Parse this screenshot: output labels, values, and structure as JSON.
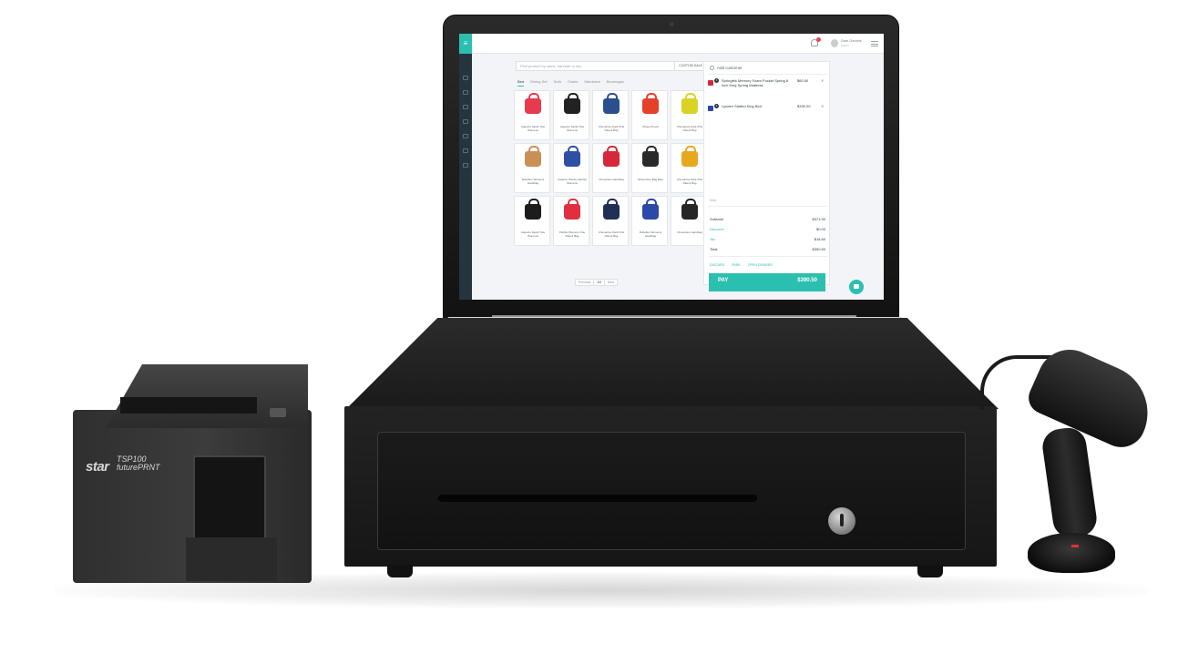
{
  "topbar": {
    "user_name": "Sam Daniels",
    "user_role": "Admin"
  },
  "search": {
    "placeholder": "Find product by name, barcode or sku",
    "custom_sale": "CUSTOM SALE"
  },
  "tabs": [
    "Bed",
    "Dining Set",
    "Sofa",
    "Chairs",
    "Wardrobe",
    "Beverages"
  ],
  "products": [
    {
      "name": "Capezio Sarah Tote Womens",
      "color": "#e63b4f"
    },
    {
      "name": "Capezio Sarah Tote Womens",
      "color": "#222222"
    },
    {
      "name": "Chevantoo Dark Pink Patent Bag",
      "color": "#2b4f8c"
    },
    {
      "name": "Shoes Pouch",
      "color": "#e4402a"
    },
    {
      "name": "Chevantoo Dark Pink Patent Bag",
      "color": "#d8d324"
    },
    {
      "name": "Rubellen Womens Handbag",
      "color": "#c98f55"
    },
    {
      "name": "Capezio Wesby Satchel Womens",
      "color": "#2e4fa3"
    },
    {
      "name": "Chevantoo Handbag",
      "color": "#d6283a"
    },
    {
      "name": "Shoes Run Bag Blue",
      "color": "#2a2a2a"
    },
    {
      "name": "Chevantoo Dark Pink Patent Bag",
      "color": "#e6a81d"
    },
    {
      "name": "Capezio Sarah Tote Womens",
      "color": "#1c1c1c"
    },
    {
      "name": "Pebble Womens Tote Patent Bag",
      "color": "#e03040"
    },
    {
      "name": "Chevantoo Dark Pink Patent Bag",
      "color": "#1f2f55"
    },
    {
      "name": "Rubellen Womens Handbag",
      "color": "#2a49a8"
    },
    {
      "name": "Chevantoo Handbag",
      "color": "#262626"
    }
  ],
  "pager": {
    "prev": "Previous",
    "current": "1/3",
    "next": "Next"
  },
  "cart": {
    "add_customer": "Add customer",
    "lines": [
      {
        "qty": "1",
        "name": "Springtek Memory Foam Pocket Spring 8 inch King Spring Mattress",
        "price": "$60.50",
        "thumb": "#d6283a"
      },
      {
        "qty": "1",
        "name": "Lynden Slatted King Bed",
        "price": "$330.00",
        "thumb": "#2a49a8"
      }
    ],
    "note": "Note",
    "subtotal_label": "Subtotal",
    "subtotal": "$371.90",
    "discount_label": "Discount",
    "discount": "$0.00",
    "tax_label": "Tax",
    "tax": "$18.60",
    "total_label": "Total",
    "total": "$390.50",
    "actions": [
      "DISCARD",
      "PARK",
      "OPEN DRAWER"
    ],
    "pay_label": "PAY",
    "pay_amount": "$390.50"
  },
  "printer": {
    "brand": "star",
    "model": "TSP100",
    "line": "futurePRNT"
  },
  "colors": {
    "accent": "#2bbfb0",
    "sidebar": "#26343f"
  }
}
